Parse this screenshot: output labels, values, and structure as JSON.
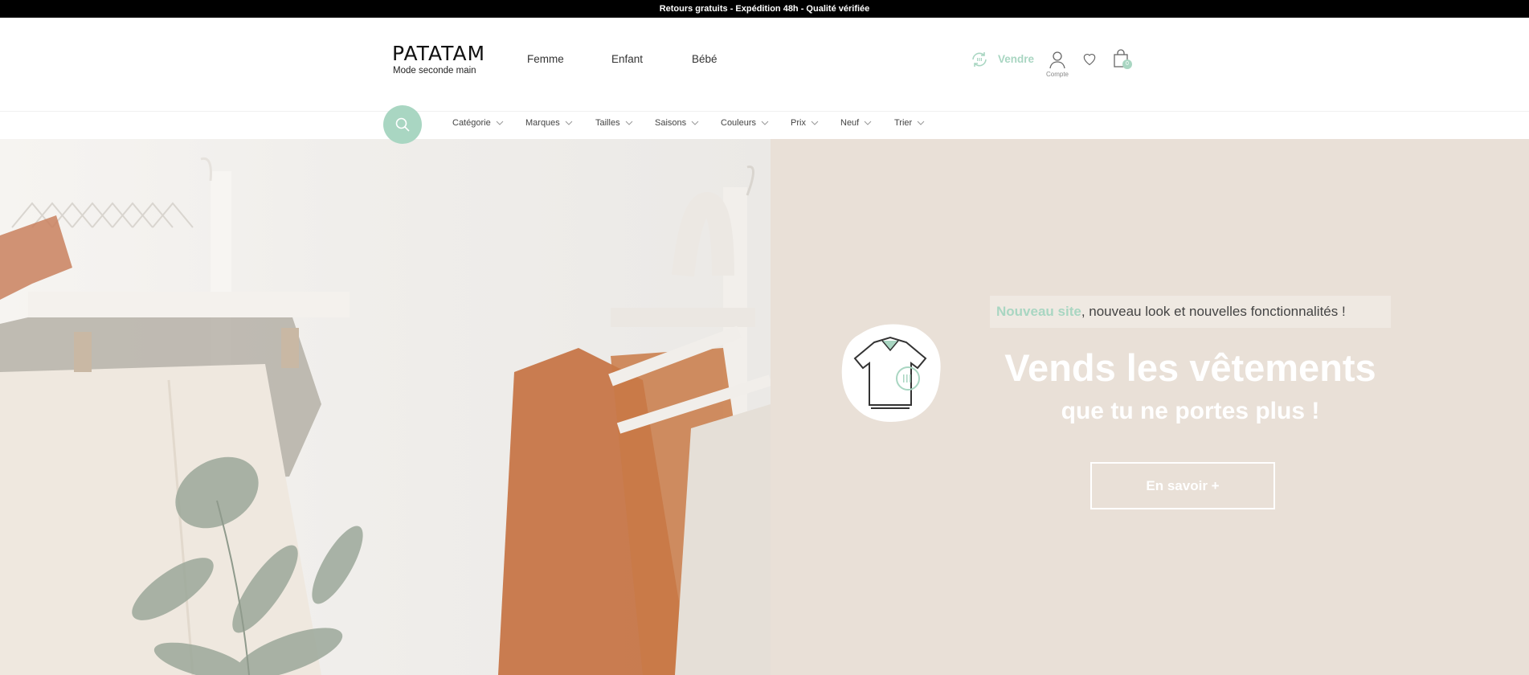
{
  "announcement": "Retours gratuits - Expédition 48h - Qualité vérifiée",
  "brand": {
    "name": "PATATAM",
    "tagline": "Mode seconde main"
  },
  "nav": [
    {
      "label": "Femme"
    },
    {
      "label": "Enfant"
    },
    {
      "label": "Bébé"
    }
  ],
  "header_actions": {
    "sell_label": "Vendre",
    "account_label": "Compte",
    "cart_count": "0"
  },
  "filters": [
    {
      "label": "Catégorie"
    },
    {
      "label": "Marques"
    },
    {
      "label": "Tailles"
    },
    {
      "label": "Saisons"
    },
    {
      "label": "Couleurs"
    },
    {
      "label": "Prix"
    },
    {
      "label": "Neuf"
    },
    {
      "label": "Trier"
    }
  ],
  "hero": {
    "intro_highlight": "Nouveau site",
    "intro_rest": ", nouveau look et nouvelles fonctionnalités !",
    "title": "Vends les vêtements",
    "subtitle": "que tu ne portes plus !",
    "cta_label": "En savoir +"
  },
  "colors": {
    "accent": "#a9d6c2",
    "topbar": "#000000",
    "hero_right_bg": "#e9e0d7"
  },
  "icons": [
    "search-icon",
    "recycle-icon",
    "user-icon",
    "heart-icon",
    "bag-icon",
    "chevron-down-icon",
    "shirt-recycle-icon"
  ]
}
